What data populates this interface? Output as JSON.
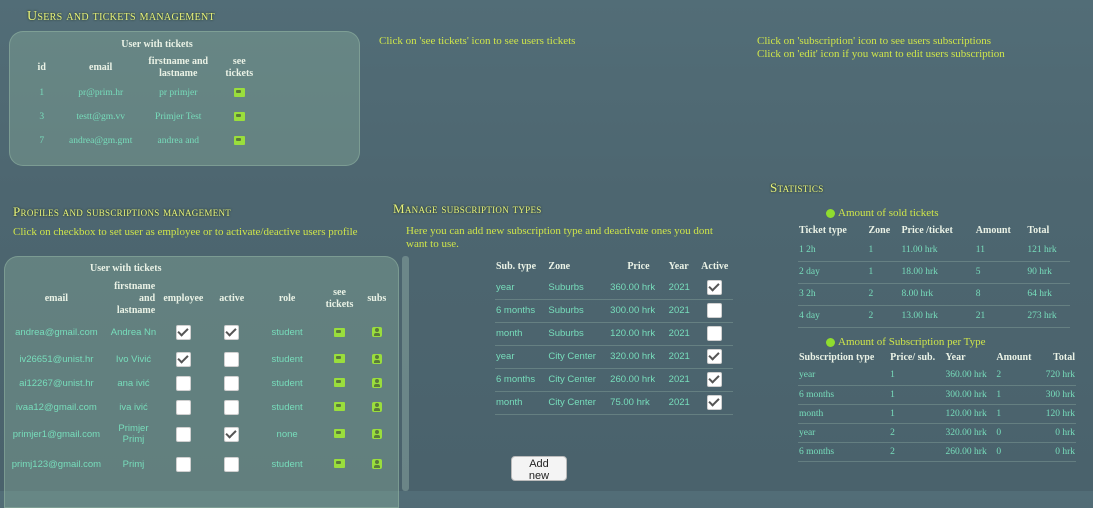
{
  "users_tickets": {
    "title": "Users and tickets management",
    "table_caption": "User with tickets",
    "headers": [
      "id",
      "email",
      "firstname and lastname",
      "see tickets"
    ],
    "rows": [
      {
        "id": "1",
        "email": "pr@prim.hr",
        "name": "pr primjer"
      },
      {
        "id": "3",
        "email": "testt@gm.vv",
        "name": "Primjer Test"
      },
      {
        "id": "7",
        "email": "andrea@gm.gmt",
        "name": "andrea and"
      }
    ],
    "hint_tickets": "Click on 'see tickets' icon to see users tickets",
    "hint_subscription": "Click on 'subscription' icon to see users subscriptions",
    "hint_edit": "Click on 'edit' icon if you want to edit users subscription"
  },
  "profiles": {
    "title": "Profiles and subscriptions management",
    "hint": "Click on checkbox to set user as employee or to activate/deactive users profile",
    "table_caption": "User with tickets",
    "headers": [
      "email",
      "firstname and lastname",
      "employee",
      "active",
      "role",
      "see tickets",
      "subs"
    ],
    "rows": [
      {
        "email": "andrea@gmail.com",
        "name": "Andrea Nn",
        "employee": true,
        "active": true,
        "role": "student"
      },
      {
        "email": "iv26651@unist.hr",
        "name": "Ivo Vivić",
        "employee": true,
        "active": false,
        "role": "student"
      },
      {
        "email": "ai12267@unist.hr",
        "name": "ana ivić",
        "employee": false,
        "active": false,
        "role": "student"
      },
      {
        "email": "ivaa12@gmail.com",
        "name": "iva ivić",
        "employee": false,
        "active": false,
        "role": "student"
      },
      {
        "email": "primjer1@gmail.com",
        "name": "Primjer Primj",
        "employee": false,
        "active": true,
        "role": "none"
      },
      {
        "email": "primj123@gmail.com",
        "name": "Primj",
        "employee": false,
        "active": false,
        "role": "student"
      }
    ]
  },
  "subscription_types": {
    "title": "Manage subscription types",
    "hint": "Here you can add new subscription type and deactivate ones you dont want to use.",
    "headers": [
      "Sub. type",
      "Zone",
      "Price",
      "Year",
      "Active"
    ],
    "rows": [
      {
        "type": "year",
        "zone": "Suburbs",
        "price": "360.00 hrk",
        "year": "2021",
        "active": true
      },
      {
        "type": "6 months",
        "zone": "Suburbs",
        "price": "300.00 hrk",
        "year": "2021",
        "active": false
      },
      {
        "type": "month",
        "zone": "Suburbs",
        "price": "120.00 hrk",
        "year": "2021",
        "active": false
      },
      {
        "type": "year",
        "zone": "City Center",
        "price": "320.00 hrk",
        "year": "2021",
        "active": true
      },
      {
        "type": "6 months",
        "zone": "City Center",
        "price": "260.00 hrk",
        "year": "2021",
        "active": true
      },
      {
        "type": "month",
        "zone": "City Center",
        "price": "75.00 hrk",
        "year": "2021",
        "active": true
      }
    ],
    "add_button": "Add new"
  },
  "statistics": {
    "title": "Statistics",
    "sold_tickets": {
      "title": "Amount of sold tickets",
      "headers": [
        "Ticket type",
        "Zone",
        "Price /ticket",
        "Amount",
        "Total"
      ],
      "rows": [
        [
          "1 2h",
          "1",
          "11.00 hrk",
          "11",
          "121 hrk"
        ],
        [
          "2 day",
          "1",
          "18.00 hrk",
          "5",
          "90 hrk"
        ],
        [
          "3 2h",
          "2",
          "8.00 hrk",
          "8",
          "64 hrk"
        ],
        [
          "4 day",
          "2",
          "13.00 hrk",
          "21",
          "273 hrk"
        ]
      ]
    },
    "subscriptions": {
      "title": "Amount of Subscription per Type",
      "headers": [
        "Subscription type",
        "Price/ sub.",
        "Year",
        "Amount",
        "Total"
      ],
      "rows": [
        [
          "year",
          "1",
          "360.00 hrk",
          "2",
          "720 hrk"
        ],
        [
          "6 months",
          "1",
          "300.00 hrk",
          "1",
          "300 hrk"
        ],
        [
          "month",
          "1",
          "120.00 hrk",
          "1",
          "120 hrk"
        ],
        [
          "year",
          "2",
          "320.00 hrk",
          "0",
          "0 hrk"
        ],
        [
          "6 months",
          "2",
          "260.00 hrk",
          "0",
          "0 hrk"
        ]
      ]
    }
  },
  "colors": {
    "title": "#e8f27a",
    "hint": "#cfe54a",
    "cell_text": "#77ddbb",
    "icon_green": "#9ade3c"
  },
  "icons": {
    "see_tickets": "ticket-icon",
    "subs": "subscription-icon",
    "bullet": "bullet-icon"
  }
}
